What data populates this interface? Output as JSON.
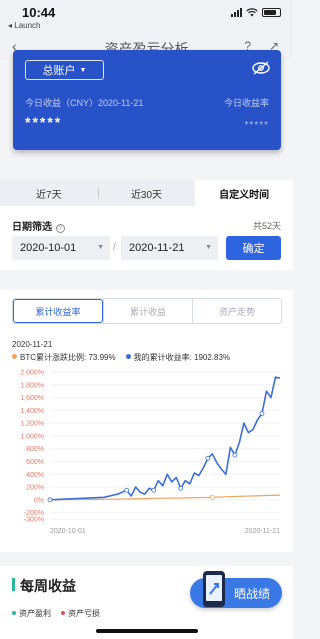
{
  "status_bar": {
    "time": "10:44",
    "back_app": "◂ Launch"
  },
  "nav": {
    "title": "资产盈亏分析"
  },
  "account_card": {
    "account_label": "总账户",
    "today_income_label": "今日收益（CNY）2020-11-21",
    "today_income_value": "*****",
    "today_rate_label": "今日收益率",
    "today_rate_value": "*****"
  },
  "time_tabs": [
    {
      "label": "近7天",
      "active": false
    },
    {
      "label": "近30天",
      "active": false
    },
    {
      "label": "自定义时间",
      "active": true
    }
  ],
  "date_filter": {
    "label": "日期筛选",
    "days_count": "共52天",
    "start_date": "2020-10-01",
    "separator": "/",
    "end_date": "2020-11-21",
    "confirm_label": "确定"
  },
  "chart_tabs": [
    {
      "label": "累计收益率",
      "active": true
    },
    {
      "label": "累计收益",
      "active": false
    },
    {
      "label": "资产走势",
      "active": false
    }
  ],
  "chart_date": "2020-11-21",
  "colors": {
    "primary": "#2f64e0",
    "btc": "#f0a35e",
    "mine": "#3a6fd8",
    "card": "#2752c8",
    "weekly_accent": "#2bb59a",
    "profit": "#2bb59a",
    "loss": "#e0505a"
  },
  "chart_data": {
    "type": "line",
    "legend": [
      {
        "name": "BTC累计涨跌比例: 73.99%",
        "color": "#f0a35e"
      },
      {
        "name": "我的累计收益率: 1902.83%",
        "color": "#3a6fd8"
      }
    ],
    "y_ticks": [
      "2,000%",
      "1,800%",
      "1,600%",
      "1,400%",
      "1,200%",
      "1,000%",
      "800%",
      "600%",
      "400%",
      "200%",
      "0%",
      "-200%",
      "-300%"
    ],
    "ylim": [
      -300,
      2000
    ],
    "x_ticks": [
      "2020-10-01",
      "2020-11-21"
    ],
    "x_range": [
      "2020-10-01",
      "2020-11-21"
    ],
    "series": [
      {
        "name": "BTC累计涨跌比例: 73.99%",
        "x": [
          "2020-10-01",
          "2020-10-07",
          "2020-10-13",
          "2020-10-19",
          "2020-10-25",
          "2020-10-31",
          "2020-11-06",
          "2020-11-12",
          "2020-11-18",
          "2020-11-21"
        ],
        "values": [
          0,
          5,
          8,
          15,
          25,
          30,
          40,
          55,
          68,
          74
        ]
      },
      {
        "name": "我的累计收益率: 1902.83%",
        "x": [
          "2020-10-01",
          "2020-10-04",
          "2020-10-07",
          "2020-10-10",
          "2020-10-13",
          "2020-10-16",
          "2020-10-18",
          "2020-10-19",
          "2020-10-20",
          "2020-10-21",
          "2020-10-22",
          "2020-10-23",
          "2020-10-24",
          "2020-10-25",
          "2020-10-26",
          "2020-10-27",
          "2020-10-28",
          "2020-10-29",
          "2020-10-30",
          "2020-10-31",
          "2020-11-01",
          "2020-11-02",
          "2020-11-03",
          "2020-11-04",
          "2020-11-05",
          "2020-11-06",
          "2020-11-07",
          "2020-11-08",
          "2020-11-09",
          "2020-11-10",
          "2020-11-11",
          "2020-11-12",
          "2020-11-13",
          "2020-11-14",
          "2020-11-15",
          "2020-11-16",
          "2020-11-17",
          "2020-11-18",
          "2020-11-19",
          "2020-11-20",
          "2020-11-21"
        ],
        "values": [
          0,
          10,
          20,
          30,
          40,
          90,
          150,
          60,
          200,
          120,
          90,
          180,
          150,
          300,
          220,
          400,
          280,
          350,
          180,
          300,
          250,
          420,
          380,
          500,
          650,
          720,
          580,
          480,
          400,
          820,
          700,
          900,
          1200,
          1050,
          1100,
          1250,
          1350,
          1700,
          1600,
          1920,
          1902.83
        ]
      }
    ],
    "grid": true
  },
  "weekly": {
    "title": "每周收益",
    "legend": [
      {
        "name": "资产盈利",
        "color": "#2bb59a"
      },
      {
        "name": "资产亏损",
        "color": "#e0505a"
      }
    ]
  },
  "share_button": {
    "label": "晒战绩"
  }
}
